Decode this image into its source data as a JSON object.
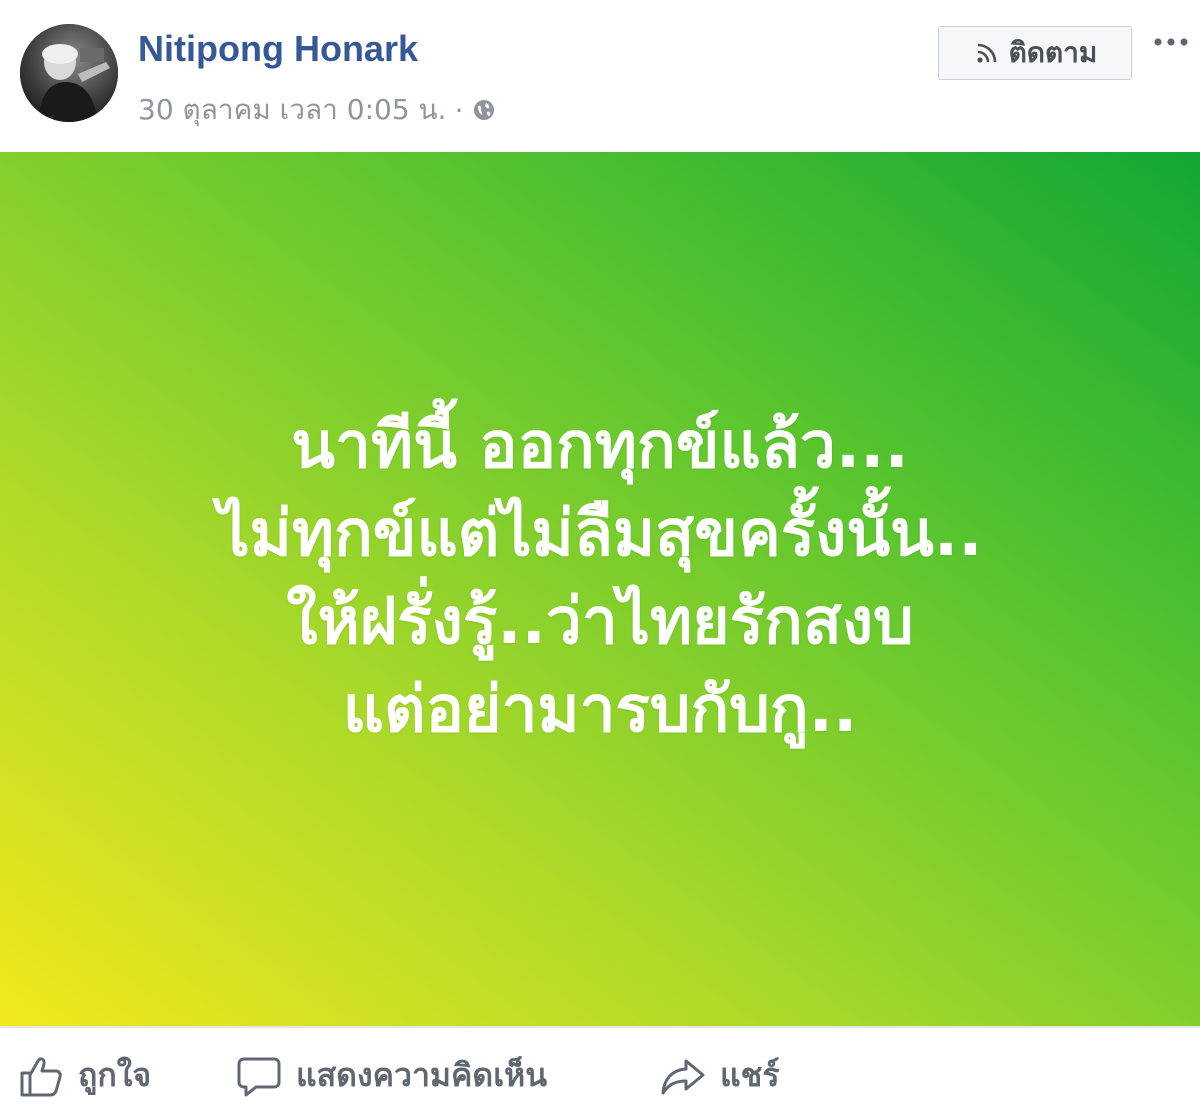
{
  "post": {
    "author": "Nitipong Honark",
    "timestamp": "30 ตุลาคม เวลา 0:05 น.",
    "separator": "·",
    "privacy_icon": "globe-icon",
    "follow_label": "ติดตาม",
    "follow_icon": "rss-icon",
    "more_icon": "more-dots-icon",
    "background_colors": [
      "#f2e81c",
      "#a6d82a",
      "#5ec62e",
      "#12a834"
    ],
    "lines": [
      "นาทีนี้ ออกทุกข์แล้ว...",
      "ไม่ทุกข์แต่ไม่ลืมสุขครั้งนั้น..",
      "ให้ฝรั่งรู้..ว่าไทยรักสงบ",
      "แต่อย่ามารบกับกู.."
    ]
  },
  "actions": {
    "like": "ถูกใจ",
    "comment": "แสดงความคิดเห็น",
    "share": "แชร์"
  },
  "colors": {
    "author_link": "#365899",
    "meta_text": "#90949c",
    "action_text": "#616770"
  }
}
